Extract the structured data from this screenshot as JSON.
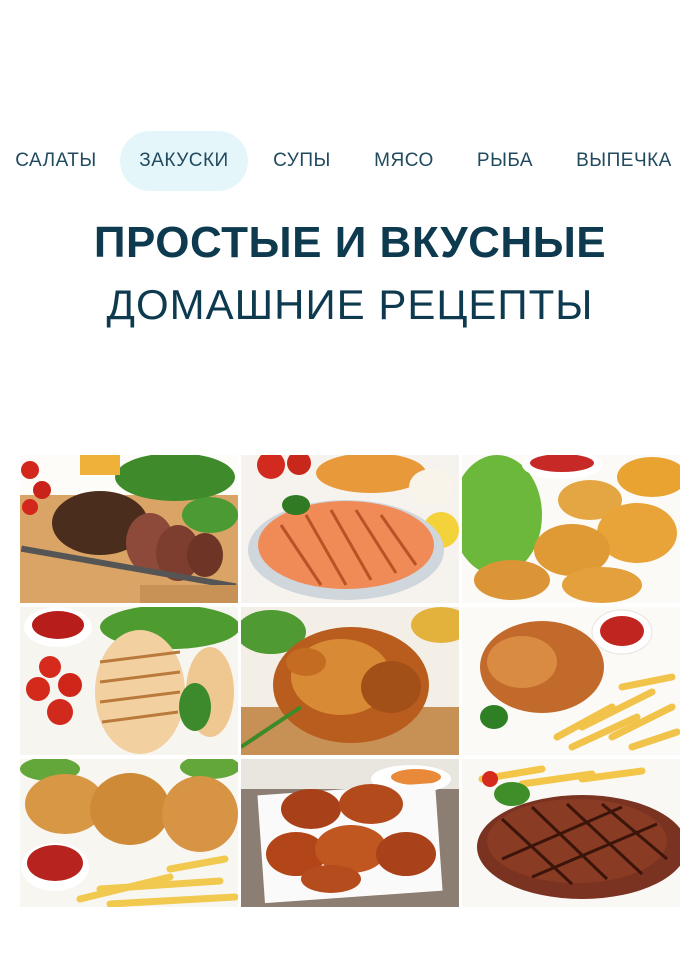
{
  "nav": {
    "items": [
      {
        "label": "САЛАТЫ",
        "active": false
      },
      {
        "label": "ЗАКУСКИ",
        "active": true
      },
      {
        "label": "СУПЫ",
        "active": false
      },
      {
        "label": "МЯСО",
        "active": false
      },
      {
        "label": "РЫБА",
        "active": false
      },
      {
        "label": "ВЫПЕЧКА",
        "active": false
      }
    ]
  },
  "hero": {
    "title": "ПРОСТЫЕ И ВКУСНЫЕ",
    "subtitle": "ДОМАШНИЕ РЕЦЕПТЫ"
  },
  "colors": {
    "text": "#0d3a4f",
    "active_pill": "#e5f6fb"
  }
}
